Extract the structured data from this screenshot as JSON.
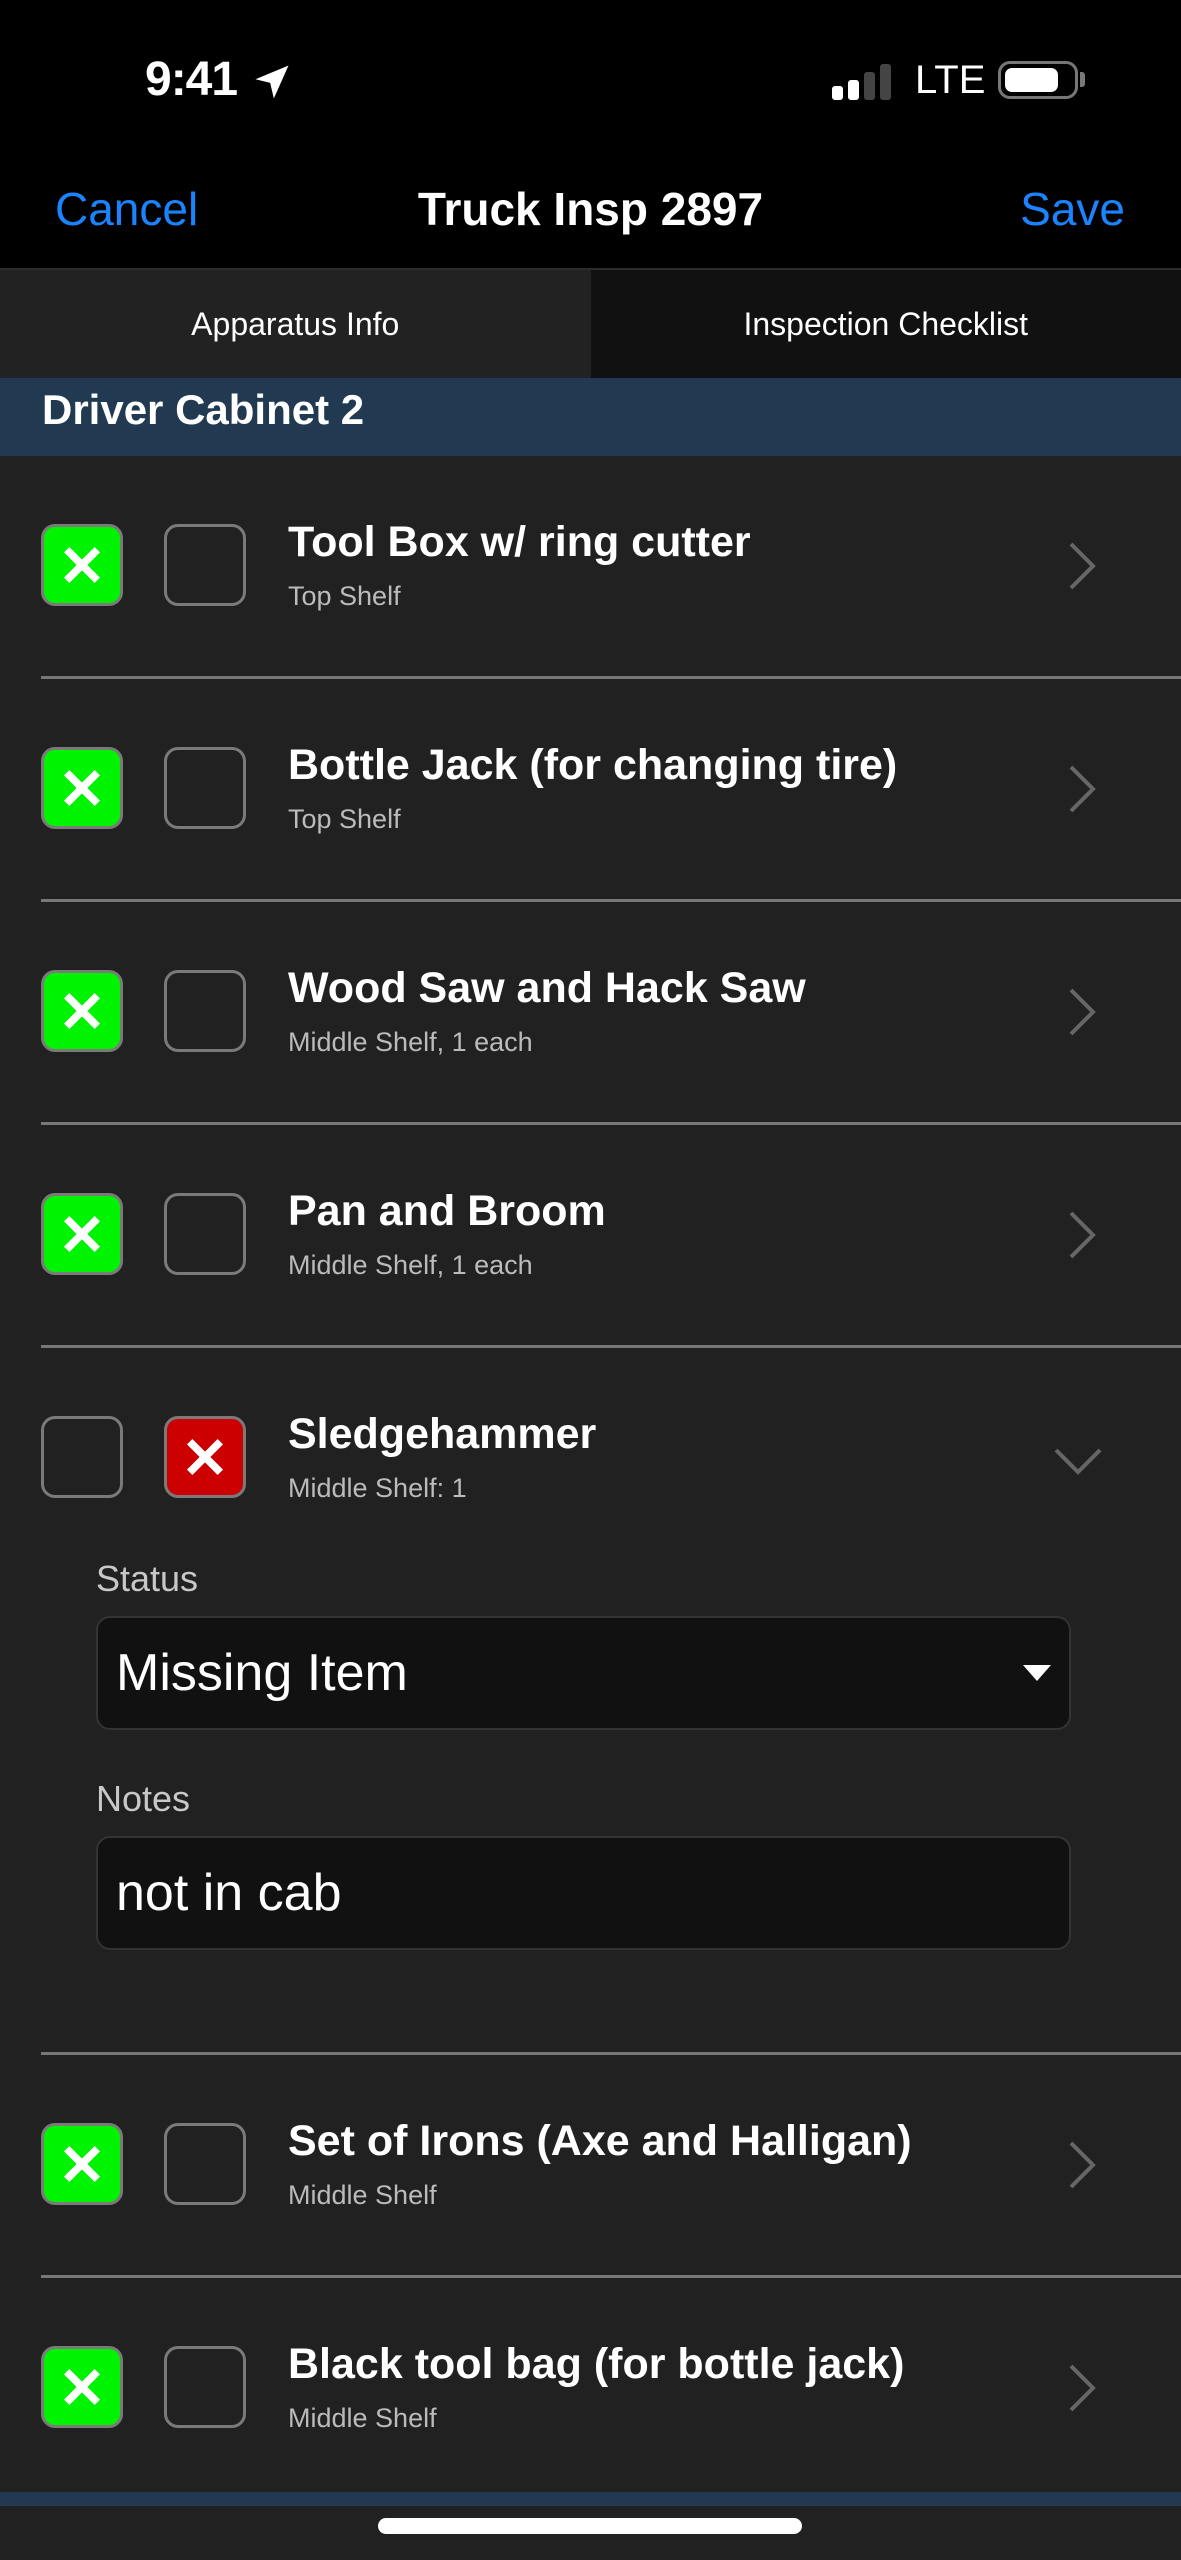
{
  "status_bar": {
    "time": "9:41",
    "location_icon": "location-arrow-icon",
    "network": "LTE",
    "signal_bars_on": 2,
    "signal_bars_total": 4,
    "battery_level": 0.8
  },
  "nav": {
    "cancel_label": "Cancel",
    "title": "Truck Insp 2897",
    "save_label": "Save",
    "accent_color": "#1a84ff"
  },
  "tabs": [
    {
      "label": "Apparatus Info",
      "active": false
    },
    {
      "label": "Inspection Checklist",
      "active": true
    }
  ],
  "section": {
    "title": "Driver Cabinet 2",
    "color": "#213a51"
  },
  "items": [
    {
      "title": "Tool Box w/ ring cutter",
      "subtitle": "Top Shelf",
      "pass": true,
      "fail": false,
      "expanded": false
    },
    {
      "title": "Bottle Jack (for changing tire)",
      "subtitle": "Top Shelf",
      "pass": true,
      "fail": false,
      "expanded": false
    },
    {
      "title": "Wood Saw and Hack Saw",
      "subtitle": "Middle Shelf, 1 each",
      "pass": true,
      "fail": false,
      "expanded": false
    },
    {
      "title": "Pan and Broom",
      "subtitle": "Middle Shelf, 1 each",
      "pass": true,
      "fail": false,
      "expanded": false
    },
    {
      "title": "Sledgehammer",
      "subtitle": "Middle Shelf: 1",
      "pass": false,
      "fail": true,
      "expanded": true,
      "detail": {
        "status_label": "Status",
        "status_value": "Missing Item",
        "notes_label": "Notes",
        "notes_value": "not in cab"
      }
    },
    {
      "title": "Set of Irons (Axe and Halligan)",
      "subtitle": "Middle Shelf",
      "pass": true,
      "fail": false,
      "expanded": false
    },
    {
      "title": "Black tool bag (for bottle jack)",
      "subtitle": "Middle Shelf",
      "pass": true,
      "fail": false,
      "expanded": false
    }
  ],
  "colors": {
    "pass": "#00f300",
    "fail": "#cc0000"
  }
}
